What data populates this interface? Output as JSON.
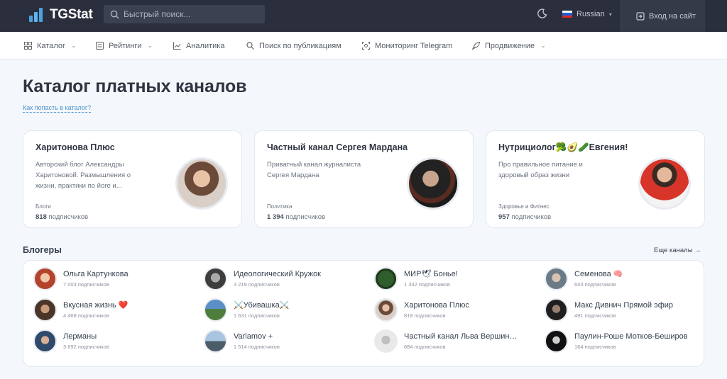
{
  "header": {
    "brand": "TGStat",
    "search_placeholder": "Быстрый поиск...",
    "language": "Russian",
    "login_label": "Вход на сайт"
  },
  "nav": [
    {
      "label": "Каталог",
      "icon": "grid-icon",
      "dropdown": true
    },
    {
      "label": "Рейтинги",
      "icon": "list-icon",
      "dropdown": true
    },
    {
      "label": "Аналитика",
      "icon": "chart-icon",
      "dropdown": false
    },
    {
      "label": "Поиск по публикациям",
      "icon": "search-icon",
      "dropdown": false
    },
    {
      "label": "Мониторинг Telegram",
      "icon": "monitor-icon",
      "dropdown": false
    },
    {
      "label": "Продвижение",
      "icon": "rocket-icon",
      "dropdown": true
    }
  ],
  "page": {
    "title": "Каталог платных каналов",
    "help_link": "Как попасть в каталог?"
  },
  "featured": [
    {
      "title": "Харитонова Плюс",
      "description": "Авторский блог Александры Харитоновой. Размышления о жизни, практики по йоге и...",
      "category": "Блоги",
      "subs_count": "818",
      "subs_label": "подписчиков"
    },
    {
      "title": "Частный канал Сергея Мардана",
      "description": "Приватный канал журналиста Сергея Мардана",
      "category": "Политика",
      "subs_count": "1 394",
      "subs_label": "подписчиков"
    },
    {
      "title": "Нутрициолог🥦🥑🥒Евгения!",
      "description": "Про правильное питание и здоровый образ жизни",
      "category": "Здоровье и Фитнес",
      "subs_count": "957",
      "subs_label": "подписчиков"
    }
  ],
  "bloggers": {
    "title": "Блогеры",
    "more_link": "Еще каналы →",
    "items": [
      {
        "name": "Ольга Картункова",
        "subs": "7 003 подписчиков"
      },
      {
        "name": "Идеологический Кружок",
        "subs": "3 219 подписчиков"
      },
      {
        "name": "МИР🕊 Боньe!",
        "subs": "1 342 подписчиков"
      },
      {
        "name": "Семенова 🧠",
        "subs": "643 подписчиков"
      },
      {
        "name": "Вкусная жизнь ❤️",
        "subs": "4 468 подписчиков"
      },
      {
        "name": "⚔️Убивашка⚔️",
        "subs": "1 631 подписчиков"
      },
      {
        "name": "Харитонова Плюс",
        "subs": "818 подписчиков"
      },
      {
        "name": "Макс Дивнич Прямой эфир",
        "subs": "491 подписчиков"
      },
      {
        "name": "Лерманы",
        "subs": "3 692 подписчиков"
      },
      {
        "name": "Varlamov +",
        "subs": "1 514 подписчиков"
      },
      {
        "name": "Частный канал Льва Вершинина",
        "subs": "684 подписчиков"
      },
      {
        "name": "Паулин-Роше Мотков-Беширов",
        "subs": "164 подписчиков"
      }
    ]
  },
  "colors": {
    "topbar": "#2b2f3d",
    "accent": "#4aa3df",
    "link": "#4a90c9",
    "background": "#f4f7fb"
  }
}
